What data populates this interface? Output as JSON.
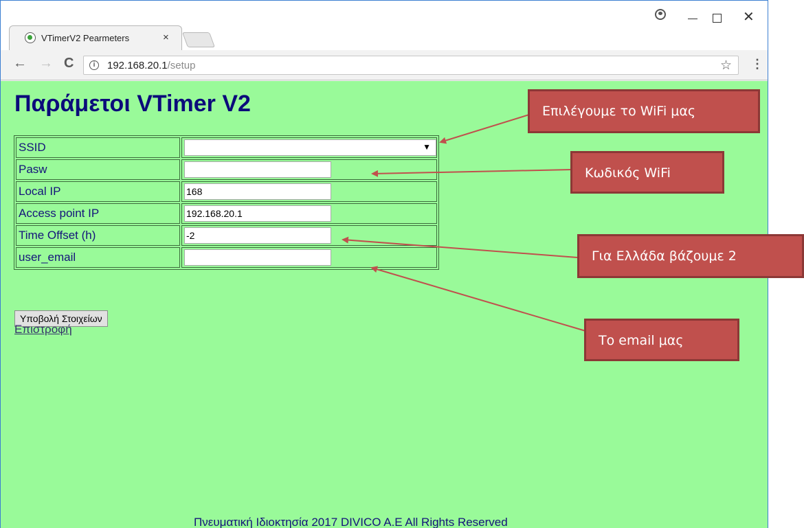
{
  "browser": {
    "tab_title": "VTimerV2 Pearmeters",
    "tab_close": "×",
    "url_host": "192.168.20.1",
    "url_path": "/setup",
    "info_glyph": "i",
    "back_glyph": "←",
    "forward_glyph": "→",
    "reload_glyph": "C",
    "star_glyph": "☆",
    "menu_glyph": "⋮",
    "close_glyph": "✕"
  },
  "page": {
    "heading": "Παράμετοι VTimer V2",
    "rows": [
      {
        "label": "SSID",
        "type": "select",
        "value": ""
      },
      {
        "label": "Pasw",
        "type": "text",
        "value": ""
      },
      {
        "label": "Local IP",
        "type": "text",
        "value": "168"
      },
      {
        "label": "Access point IP",
        "type": "text",
        "value": "192.168.20.1"
      },
      {
        "label": "Time Offset (h)",
        "type": "text",
        "value": "-2"
      },
      {
        "label": "user_email",
        "type": "text",
        "value": ""
      }
    ],
    "select_arrow": "▼",
    "submit_label": "Υποβολή Στοιχείων",
    "back_link": "Επιστροφή",
    "footer": "Πνευματική Ιδιοκτησία 2017 DIVICO A.E All Rights Reserved"
  },
  "annotations": {
    "wifi": "Επιλέγουμε το WiFi μας",
    "password": "Κωδικός WiFi",
    "offset": "Για Ελλάδα βάζουμε 2",
    "email": "Το email μας"
  },
  "colors": {
    "page_background": "#99fa99",
    "heading": "#0b0b7a",
    "callout_fill": "#c0504d",
    "callout_border": "#8c3836"
  }
}
